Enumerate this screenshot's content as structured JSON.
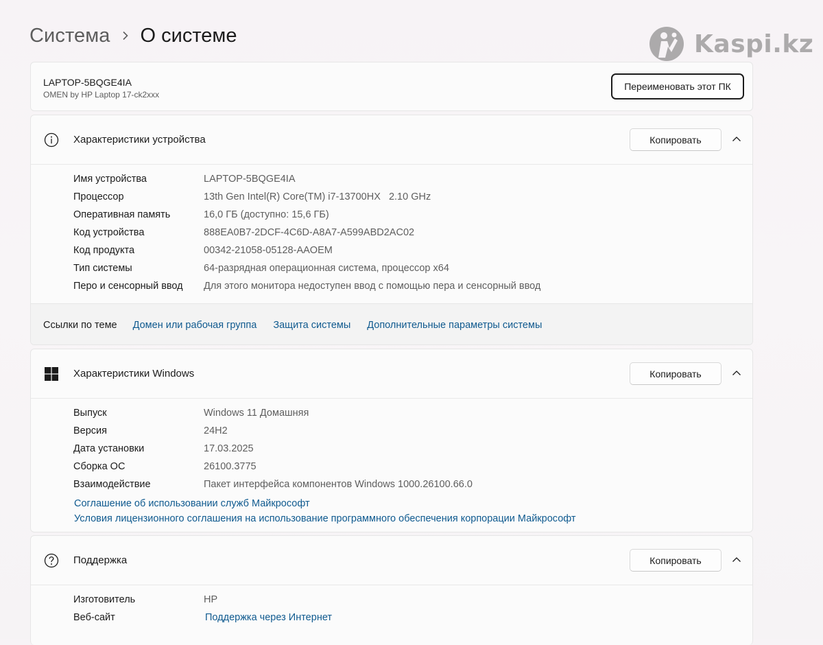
{
  "header": {
    "breadcrumb_parent": "Система",
    "breadcrumb_current": "О системе"
  },
  "watermark": {
    "text": "Kaspi.kz"
  },
  "pc": {
    "name": "LAPTOP-5BQGE4IA",
    "model": "OMEN by HP Laptop 17-ck2xxx",
    "rename_button": "Переименовать этот ПК"
  },
  "device_specs": {
    "title": "Характеристики устройства",
    "icon": "info-icon",
    "copy_button": "Копировать",
    "rows": [
      {
        "label": "Имя устройства",
        "value": "LAPTOP-5BQGE4IA"
      },
      {
        "label": "Процессор",
        "value": "13th Gen Intel(R) Core(TM) i7-13700HX   2.10 GHz"
      },
      {
        "label": "Оперативная память",
        "value": "16,0 ГБ (доступно: 15,6 ГБ)"
      },
      {
        "label": "Код устройства",
        "value": "888EA0B7-2DCF-4C6D-A8A7-A599ABD2AC02"
      },
      {
        "label": "Код продукта",
        "value": "00342-21058-05128-AAOEM"
      },
      {
        "label": "Тип системы",
        "value": "64-разрядная операционная система, процессор x64"
      },
      {
        "label": "Перо и сенсорный ввод",
        "value": "Для этого монитора недоступен ввод с помощью пера и сенсорный ввод"
      }
    ],
    "related_title": "Ссылки по теме",
    "related_links": [
      "Домен или рабочая группа",
      "Защита системы",
      "Дополнительные параметры системы"
    ]
  },
  "windows_specs": {
    "title": "Характеристики Windows",
    "icon": "windows-logo-icon",
    "copy_button": "Копировать",
    "rows": [
      {
        "label": "Выпуск",
        "value": "Windows 11 Домашняя"
      },
      {
        "label": "Версия",
        "value": "24H2"
      },
      {
        "label": "Дата установки",
        "value": "17.03.2025"
      },
      {
        "label": "Сборка ОС",
        "value": "26100.3775"
      },
      {
        "label": "Взаимодействие",
        "value": "Пакет интерфейса компонентов Windows 1000.26100.66.0"
      }
    ],
    "links": [
      "Соглашение об использовании служб Майкрософт",
      "Условия лицензионного соглашения на использование программного обеспечения корпорации Майкрософт"
    ]
  },
  "support": {
    "title": "Поддержка",
    "icon": "help-icon",
    "copy_button": "Копировать",
    "rows": [
      {
        "label": "Изготовитель",
        "value": "HP"
      },
      {
        "label": "Веб-сайт",
        "value": "Поддержка через Интернет"
      }
    ]
  },
  "colors": {
    "link": "#0f5a8f",
    "background": "#f7f4f6",
    "card": "#fbfbfb"
  }
}
